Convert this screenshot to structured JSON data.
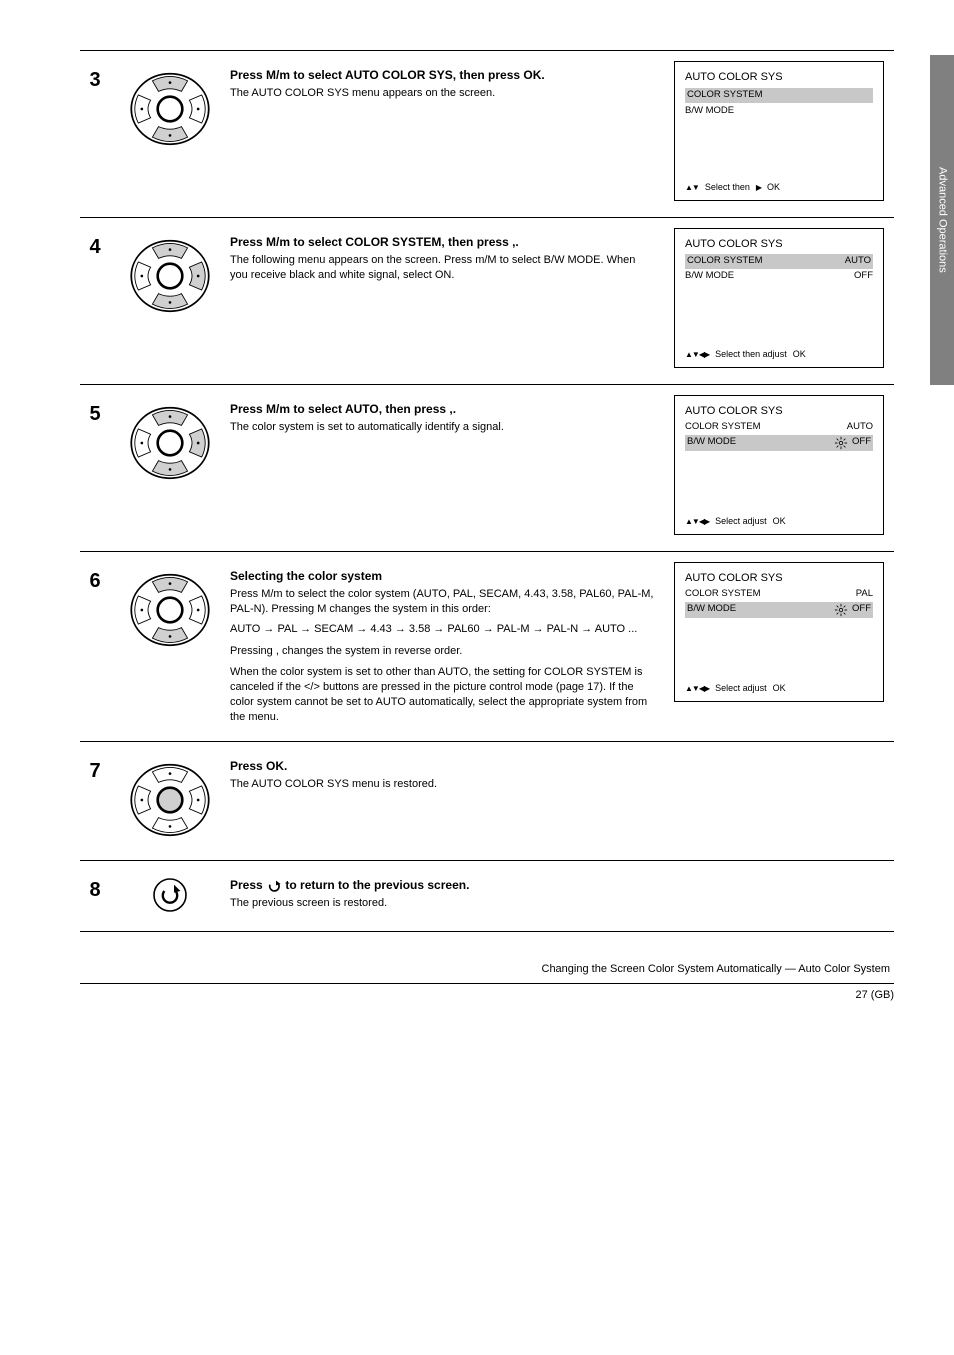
{
  "sideTab": "Advanced Operations",
  "steps": {
    "s3": {
      "num": "3",
      "title_before": "Press ",
      "arrows": "M/m",
      "title_after": " to select AUTO COLOR SYS, then press OK.",
      "body": "The AUTO COLOR SYS menu appears on the screen.",
      "screen": {
        "title": "AUTO COLOR SYS",
        "line1hl": "COLOR SYSTEM",
        "line2": "B/W MODE",
        "bottom_sel": "Select    then",
        "bottom_ok": "OK"
      }
    },
    "s4": {
      "num": "4",
      "title": "Press M/m to select COLOR SYSTEM, then press ,.",
      "body_before": "The following menu appears on the screen. Press ",
      "body_arrows": "m/M",
      "body_after": " to select B/W MODE. When you receive black and white signal, select ON.",
      "screen": {
        "title": "AUTO COLOR SYS",
        "l1l": "COLOR SYSTEM",
        "l1r": "AUTO",
        "l2l": "B/W MODE",
        "l2r": "OFF",
        "bottom_sel": "Select     then adjust",
        "bottom_ok": "OK"
      }
    },
    "s5": {
      "num": "5",
      "title": "Press M/m to select AUTO, then press ,.",
      "body": "The color system is set to automatically identify a signal.",
      "screen": {
        "title": "AUTO COLOR SYS",
        "l1l": "COLOR SYSTEM",
        "l1r": "AUTO",
        "l2l": "B/W MODE",
        "l2r": "OFF",
        "bottom_sel": "Select       adjust",
        "bottom_ok": "OK"
      }
    },
    "s6": {
      "num": "6",
      "title": "Selecting the color system",
      "body_l1_before": "Press ",
      "body_l1_arrows": "M/m",
      "body_l1_after": " to select the color system (AUTO, PAL, SECAM, 4.43, 3.58, PAL60, PAL-M, PAL-N). ",
      "body_l1_tail": "Pressing M changes the system in this order:",
      "seq": "AUTO → PAL → SECAM → 4.43 → 3.58 → PAL60 → PAL-M → PAL-N → AUTO ...",
      "body_l2": "Pressing , changes the system in reverse order.",
      "body_note": "When the color system is set to other than AUTO, the setting for COLOR SYSTEM is canceled if the </> buttons are pressed in the picture control mode (page 17). If the color system cannot be set to AUTO automatically, select the appropriate system from the menu.",
      "screen": {
        "title": "AUTO COLOR SYS",
        "l1l": "COLOR SYSTEM",
        "l1r": "PAL",
        "l2l": "B/W MODE",
        "l2r": "OFF",
        "bottom_sel": "Select       adjust",
        "bottom_ok": "OK"
      }
    },
    "s7": {
      "num": "7",
      "title": "Press OK.",
      "body": "The AUTO COLOR SYS menu is restored."
    },
    "s8": {
      "num": "8",
      "title_before": "Press ",
      "title_after": " to return to the previous screen.",
      "body": "The previous screen is restored."
    }
  },
  "footer": {
    "line": "Changing the Screen Color System Automatically — Auto Color System",
    "page": "27 (GB)"
  }
}
